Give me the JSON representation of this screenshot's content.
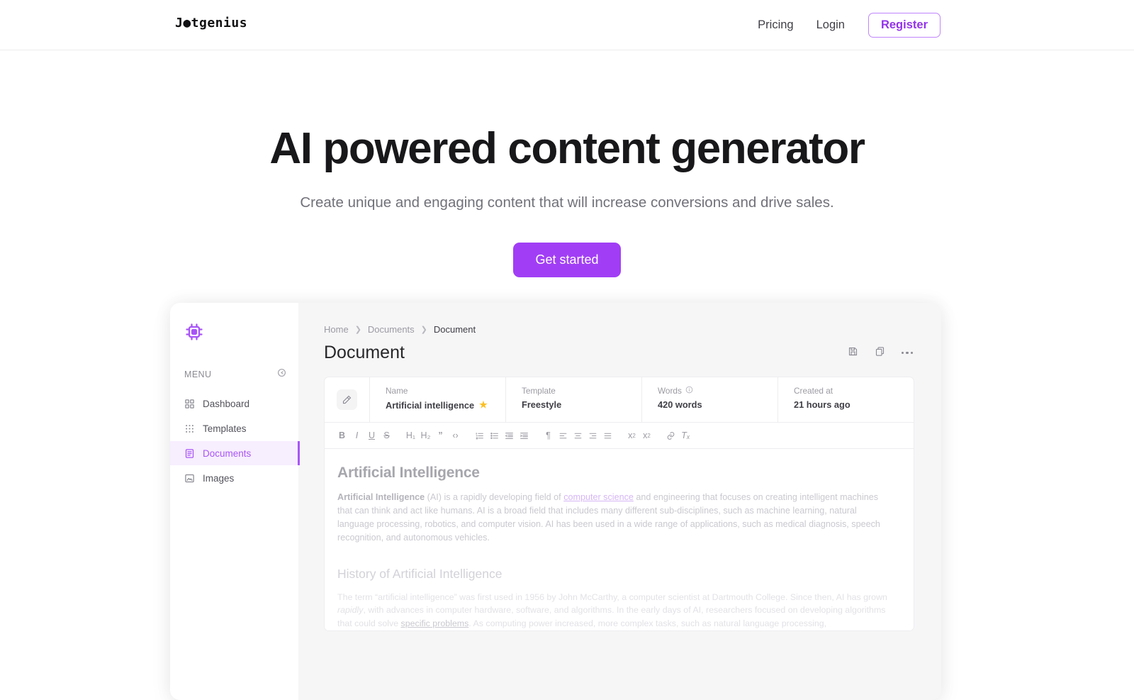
{
  "topnav": {
    "logo": "J●tgenius",
    "links": [
      {
        "label": "Pricing",
        "name": "nav-pricing"
      },
      {
        "label": "Login",
        "name": "nav-login"
      }
    ],
    "register_label": "Register",
    "accent": "#9333ea"
  },
  "hero": {
    "title": "AI powered content generator",
    "subtitle": "Create unique and engaging content that will increase conversions and drive sales.",
    "cta_label": "Get started",
    "cta_color": "#a13ef5"
  },
  "app": {
    "sidebar": {
      "logo_icon": "cpu-chip-icon",
      "menu_label": "MENU",
      "menu_toggle_icon": "collapse-circle-icon",
      "items": [
        {
          "label": "Dashboard",
          "icon": "grid-squares-icon",
          "active": false
        },
        {
          "label": "Templates",
          "icon": "dots-grid-icon",
          "active": false
        },
        {
          "label": "Documents",
          "icon": "document-list-icon",
          "active": true
        },
        {
          "label": "Images",
          "icon": "image-icon",
          "active": false
        }
      ],
      "active_color": "#a855f7"
    },
    "breadcrumb": [
      "Home",
      "Documents",
      "Document"
    ],
    "page_title": "Document",
    "actions": [
      {
        "name": "save-button",
        "icon": "floppy-save-icon"
      },
      {
        "name": "duplicate-button",
        "icon": "copy-icon"
      },
      {
        "name": "more-button",
        "icon": "ellipsis-icon"
      }
    ],
    "meta": {
      "doc_icon": "magic-pencil-icon",
      "fields": [
        {
          "label": "Name",
          "value": "Artificial intelligence",
          "starred": true,
          "star_glyph": "★"
        },
        {
          "label": "Template",
          "value": "Freestyle",
          "starred": false
        },
        {
          "label": "Words",
          "value": "420 words",
          "info_icon": "info-circle-icon",
          "starred": false
        },
        {
          "label": "Created at",
          "value": "21 hours ago",
          "starred": false
        }
      ]
    },
    "toolbar": [
      {
        "name": "bold-button",
        "glyph": "B",
        "style": "bold"
      },
      {
        "name": "italic-button",
        "glyph": "I",
        "style": "italic"
      },
      {
        "name": "underline-button",
        "glyph": "U",
        "style": "underline"
      },
      {
        "name": "strikethrough-button",
        "glyph": "S",
        "style": "strike"
      },
      {
        "name": "heading-1-button",
        "glyph": "H₁",
        "style": ""
      },
      {
        "name": "heading-2-button",
        "glyph": "H₂",
        "style": ""
      },
      {
        "name": "blockquote-button",
        "glyph": "”",
        "style": ""
      },
      {
        "name": "code-block-button",
        "glyph": "‹›",
        "style": ""
      },
      {
        "name": "ordered-list-button",
        "glyph": "≡",
        "style": ""
      },
      {
        "name": "bullet-list-button",
        "glyph": "≡",
        "style": ""
      },
      {
        "name": "outdent-button",
        "glyph": "≡",
        "style": ""
      },
      {
        "name": "indent-button",
        "glyph": "≡",
        "style": ""
      },
      {
        "name": "text-direction-button",
        "glyph": "¶",
        "style": ""
      },
      {
        "name": "align-left-button",
        "glyph": "≡",
        "style": ""
      },
      {
        "name": "align-center-button",
        "glyph": "≡",
        "style": ""
      },
      {
        "name": "align-right-button",
        "glyph": "≡",
        "style": ""
      },
      {
        "name": "align-justify-button",
        "glyph": "≡",
        "style": ""
      },
      {
        "name": "subscript-button",
        "glyph": "x",
        "style": "sub"
      },
      {
        "name": "superscript-button",
        "glyph": "x",
        "style": "sup"
      },
      {
        "name": "link-button",
        "glyph": "⚭",
        "style": ""
      },
      {
        "name": "clear-format-button",
        "glyph": "Tₓ",
        "style": ""
      }
    ],
    "document": {
      "h1": "Artificial Intelligence",
      "p1_bold": "Artificial Intelligence",
      "p1_a": " (AI) is a rapidly developing field of ",
      "p1_link": "computer science",
      "p1_b": " and engineering that focuses on creating intelligent machines that can think and act like humans. AI is a broad field that includes many different sub-disciplines, such as machine learning, natural language processing, robotics, and computer vision. AI has been used in a wide range of applications, such as medical diagnosis, speech recognition, and autonomous vehicles.",
      "h2": "History of Artificial Intelligence",
      "p2_a": "The term “artificial intelligence” was first used in 1956 by John McCarthy, a computer scientist at Dartmouth College. Since then, AI has grown ",
      "p2_italic": "rapidly",
      "p2_b": ", with advances in computer hardware, software, and algorithms. In the early days of AI, researchers focused on developing algorithms that could solve ",
      "p2_link": "specific problems",
      "p2_c": ". As computing power increased, more complex tasks, such as natural language processing,"
    }
  }
}
